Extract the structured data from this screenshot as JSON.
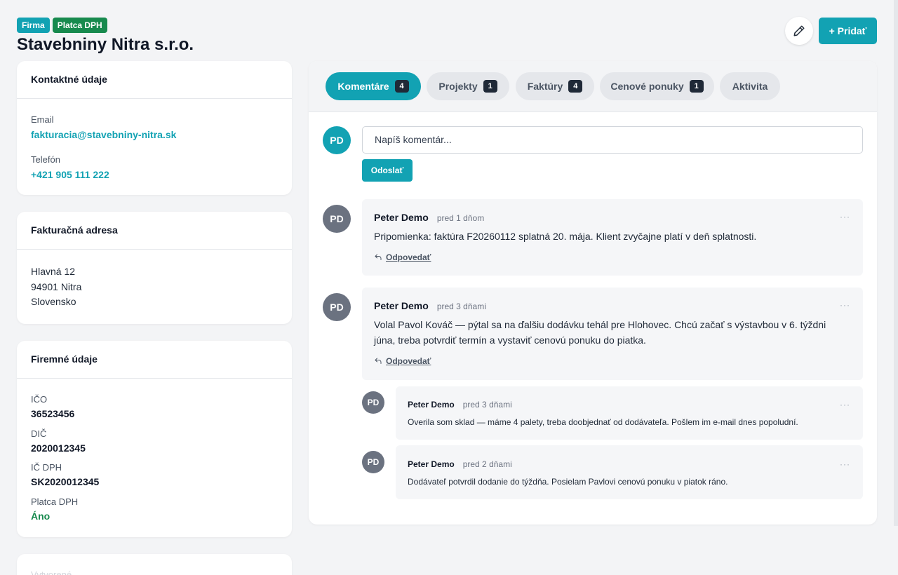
{
  "header": {
    "badges": [
      "Firma",
      "Platca DPH"
    ],
    "title": "Stavebniny Nitra s.r.o.",
    "edit_icon": "pencil-icon",
    "add_label": "+ Pridať"
  },
  "contact": {
    "heading": "Kontaktné údaje",
    "email_label": "Email",
    "email": "fakturacia@stavebniny-nitra.sk",
    "phone_label": "Telefón",
    "phone": "+421 905 111 222"
  },
  "billing": {
    "heading": "Fakturačná adresa",
    "lines": [
      "Hlavná 12",
      "94901 Nitra",
      "Slovensko"
    ]
  },
  "company": {
    "heading": "Firemné údaje",
    "fields": [
      {
        "label": "IČO",
        "value": "36523456"
      },
      {
        "label": "DIČ",
        "value": "2020012345"
      },
      {
        "label": "IČ DPH",
        "value": "SK2020012345"
      },
      {
        "label": "Platca DPH",
        "value": "Áno"
      }
    ]
  },
  "faded_card": {
    "heading": "Vytvorené"
  },
  "tabs": [
    {
      "label": "Komentáre",
      "count": "4",
      "active": true
    },
    {
      "label": "Projekty",
      "count": "1"
    },
    {
      "label": "Faktúry",
      "count": "4"
    },
    {
      "label": "Cenové ponuky",
      "count": "1"
    },
    {
      "label": "Aktivita"
    }
  ],
  "composer": {
    "avatar": "PD",
    "placeholder": "Napíš komentár...",
    "send_label": "Odoslať"
  },
  "comments": [
    {
      "avatar": "PD",
      "author": "Peter Demo",
      "time": "pred 1 dňom",
      "text": "Pripomienka: faktúra F20260112 splatná 20. mája. Klient zvyčajne platí v deň splatnosti.",
      "reply": "Odpovedať",
      "menu": "···"
    },
    {
      "avatar": "PD",
      "author": "Peter Demo",
      "time": "pred 3 dňami",
      "text": "Volal Pavol Kováč — pýtal sa na ďalšiu dodávku tehál pre Hlohovec. Chcú začať s výstavbou v 6. týždni júna, treba potvrdiť termín a vystaviť cenovú ponuku do piatka.",
      "reply": "Odpovedať",
      "menu": "···",
      "replies": [
        {
          "avatar": "PD",
          "author": "Peter Demo",
          "time": "pred 3 dňami",
          "text": "Overila som sklad — máme 4 palety, treba doobjednať od dodávateľa. Pošlem im e-mail dnes popoludní.",
          "menu": "···"
        },
        {
          "avatar": "PD",
          "author": "Peter Demo",
          "time": "pred 2 dňami",
          "text": "Dodávateľ potvrdil dodanie do týždňa. Posielam Pavlovi cenovú ponuku v piatok ráno.",
          "menu": "···"
        }
      ]
    }
  ]
}
